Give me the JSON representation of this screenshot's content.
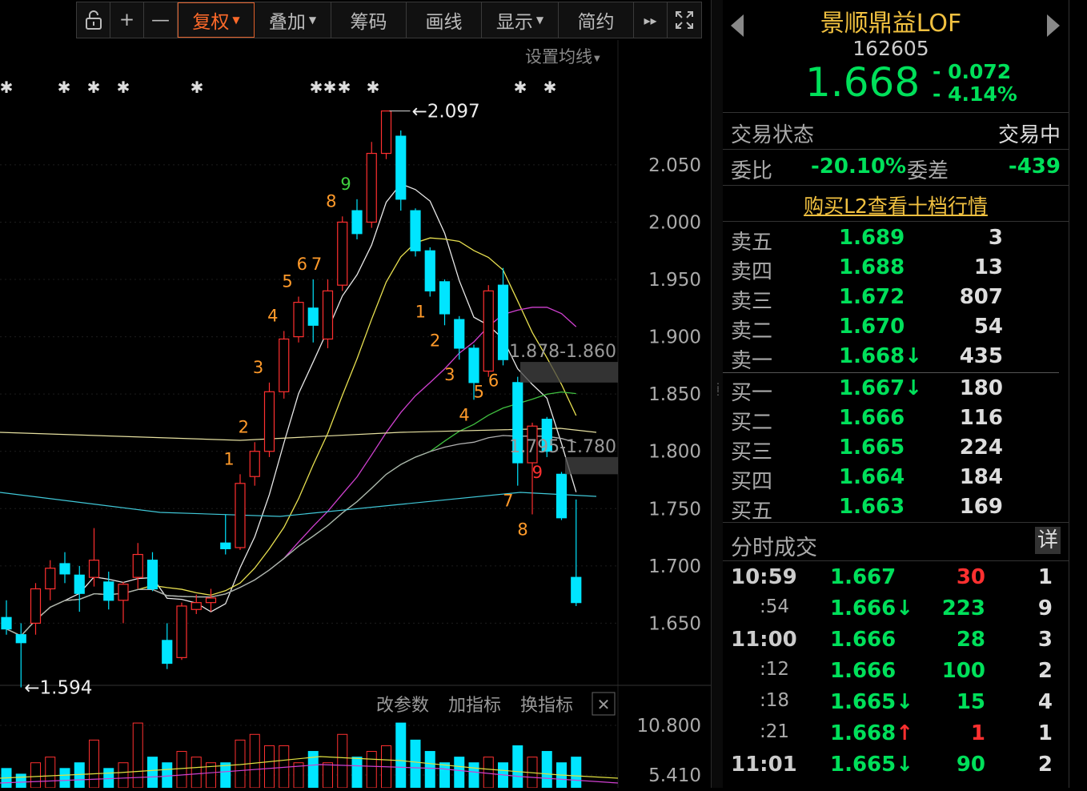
{
  "toolbar": {
    "items": [
      {
        "label": "",
        "icon": "lock-icon"
      },
      {
        "label": "+",
        "icon": "zoom-in-icon"
      },
      {
        "label": "—",
        "icon": "zoom-out-icon"
      },
      {
        "label": "复权",
        "dropdown": true,
        "active": true
      },
      {
        "label": "叠加",
        "dropdown": true
      },
      {
        "label": "筹码"
      },
      {
        "label": "画线"
      },
      {
        "label": "显示",
        "dropdown": true
      },
      {
        "label": "简约"
      },
      {
        "label": "▸▸",
        "icon": "fast-forward-icon"
      },
      {
        "label": "",
        "icon": "fullscreen-icon"
      }
    ]
  },
  "chart": {
    "ma_settings": "设置均线",
    "price_high_label": "2.097",
    "price_low_label": "1.594",
    "box1_label": "1.878-1.860",
    "box2_label": "1.795-1.780",
    "y_ticks": [
      "2.050",
      "2.000",
      "1.950",
      "1.900",
      "1.850",
      "1.800",
      "1.750",
      "1.700",
      "1.650"
    ],
    "indicator_buttons": [
      "改参数",
      "加指标",
      "换指标"
    ],
    "vol_ticks": [
      "10.800",
      "5.410"
    ],
    "td_up": [
      "1",
      "2",
      "3",
      "4",
      "5",
      "6",
      "7",
      "8",
      "9"
    ],
    "td_down": [
      "1",
      "2",
      "3",
      "4",
      "5",
      "6",
      "7",
      "8",
      "9"
    ]
  },
  "chart_data": {
    "type": "candlestick",
    "ylim": [
      1.6,
      2.11
    ],
    "candles": [
      {
        "o": 1.655,
        "c": 1.645,
        "h": 1.67,
        "l": 1.64
      },
      {
        "o": 1.64,
        "c": 1.633,
        "h": 1.65,
        "l": 1.594
      },
      {
        "o": 1.65,
        "c": 1.68,
        "h": 1.685,
        "l": 1.64
      },
      {
        "o": 1.68,
        "c": 1.698,
        "h": 1.705,
        "l": 1.67
      },
      {
        "o": 1.702,
        "c": 1.693,
        "h": 1.712,
        "l": 1.685
      },
      {
        "o": 1.692,
        "c": 1.676,
        "h": 1.7,
        "l": 1.66
      },
      {
        "o": 1.69,
        "c": 1.705,
        "h": 1.733,
        "l": 1.682
      },
      {
        "o": 1.686,
        "c": 1.67,
        "h": 1.695,
        "l": 1.662
      },
      {
        "o": 1.67,
        "c": 1.684,
        "h": 1.686,
        "l": 1.65
      },
      {
        "o": 1.69,
        "c": 1.71,
        "h": 1.72,
        "l": 1.68
      },
      {
        "o": 1.705,
        "c": 1.68,
        "h": 1.712,
        "l": 1.678
      },
      {
        "o": 1.635,
        "c": 1.615,
        "h": 1.65,
        "l": 1.61
      },
      {
        "o": 1.62,
        "c": 1.665,
        "h": 1.668,
        "l": 1.618
      },
      {
        "o": 1.662,
        "c": 1.668,
        "h": 1.675,
        "l": 1.658
      },
      {
        "o": 1.668,
        "c": 1.672,
        "h": 1.68,
        "l": 1.66
      },
      {
        "o": 1.72,
        "c": 1.715,
        "h": 1.745,
        "l": 1.71
      },
      {
        "o": 1.716,
        "c": 1.772,
        "h": 1.78,
        "l": 1.714
      },
      {
        "o": 1.778,
        "c": 1.8,
        "h": 1.808,
        "l": 1.77
      },
      {
        "o": 1.8,
        "c": 1.852,
        "h": 1.86,
        "l": 1.795
      },
      {
        "o": 1.852,
        "c": 1.898,
        "h": 1.905,
        "l": 1.846
      },
      {
        "o": 1.9,
        "c": 1.93,
        "h": 1.935,
        "l": 1.895
      },
      {
        "o": 1.925,
        "c": 1.91,
        "h": 1.95,
        "l": 1.895
      },
      {
        "o": 1.898,
        "c": 1.94,
        "h": 1.95,
        "l": 1.89
      },
      {
        "o": 1.945,
        "c": 2.0,
        "h": 2.005,
        "l": 1.94
      },
      {
        "o": 2.01,
        "c": 1.99,
        "h": 2.02,
        "l": 1.985
      },
      {
        "o": 2.0,
        "c": 2.06,
        "h": 2.07,
        "l": 1.995
      },
      {
        "o": 2.06,
        "c": 2.097,
        "h": 2.097,
        "l": 2.055
      },
      {
        "o": 2.075,
        "c": 2.02,
        "h": 2.08,
        "l": 2.01
      },
      {
        "o": 2.01,
        "c": 1.975,
        "h": 2.012,
        "l": 1.97
      },
      {
        "o": 1.975,
        "c": 1.94,
        "h": 1.978,
        "l": 1.935
      },
      {
        "o": 1.948,
        "c": 1.92,
        "h": 1.95,
        "l": 1.91
      },
      {
        "o": 1.915,
        "c": 1.89,
        "h": 1.918,
        "l": 1.88
      },
      {
        "o": 1.89,
        "c": 1.86,
        "h": 1.893,
        "l": 1.845
      },
      {
        "o": 1.87,
        "c": 1.94,
        "h": 1.945,
        "l": 1.865
      },
      {
        "o": 1.945,
        "c": 1.88,
        "h": 1.96,
        "l": 1.875
      },
      {
        "o": 1.86,
        "c": 1.79,
        "h": 1.865,
        "l": 1.77
      },
      {
        "o": 1.79,
        "c": 1.822,
        "h": 1.825,
        "l": 1.745
      },
      {
        "o": 1.828,
        "c": 1.8,
        "h": 1.83,
        "l": 1.795
      },
      {
        "o": 1.78,
        "c": 1.742,
        "h": 1.782,
        "l": 1.74
      },
      {
        "o": 1.69,
        "c": 1.668,
        "h": 1.758,
        "l": 1.665
      }
    ],
    "volume": [
      2,
      1,
      3,
      4,
      2,
      3,
      7,
      2,
      3,
      10,
      4,
      3,
      5,
      4,
      3,
      3,
      7,
      8,
      6,
      6,
      3,
      5,
      3,
      8,
      4,
      5,
      6,
      10,
      7,
      5,
      3,
      4,
      3,
      4,
      3,
      6,
      4,
      5,
      3,
      4
    ],
    "vol_ylim": [
      0,
      11
    ]
  },
  "quote": {
    "name": "景顺鼎益LOF",
    "code": "162605",
    "price": "1.668",
    "change": "- 0.072",
    "change_pct": "- 4.14%",
    "status_label": "交易状态",
    "status_value": "交易中",
    "ratio_label": "委比",
    "ratio_value": "-20.10%",
    "diff_label": "委差",
    "diff_value": "-439",
    "l2_link": "购买L2查看十档行情",
    "asks": [
      {
        "label": "卖五",
        "price": "1.689",
        "vol": "3",
        "arrow": ""
      },
      {
        "label": "卖四",
        "price": "1.688",
        "vol": "13",
        "arrow": ""
      },
      {
        "label": "卖三",
        "price": "1.672",
        "vol": "807",
        "arrow": ""
      },
      {
        "label": "卖二",
        "price": "1.670",
        "vol": "54",
        "arrow": ""
      },
      {
        "label": "卖一",
        "price": "1.668",
        "vol": "435",
        "arrow": "↓"
      }
    ],
    "bids": [
      {
        "label": "买一",
        "price": "1.667",
        "vol": "180",
        "arrow": "↓"
      },
      {
        "label": "买二",
        "price": "1.666",
        "vol": "116",
        "arrow": ""
      },
      {
        "label": "买三",
        "price": "1.665",
        "vol": "224",
        "arrow": ""
      },
      {
        "label": "买四",
        "price": "1.664",
        "vol": "184",
        "arrow": ""
      },
      {
        "label": "买五",
        "price": "1.663",
        "vol": "169",
        "arrow": ""
      }
    ],
    "ticks_title": "分时成交",
    "ticks_detail": "详",
    "ticks": [
      {
        "time": "10:59",
        "sub": false,
        "price": "1.667",
        "arrow": "",
        "vol": "30",
        "vcolor": "red",
        "n": "1"
      },
      {
        "time": ":54",
        "sub": true,
        "price": "1.666",
        "arrow": "↓",
        "vol": "223",
        "vcolor": "green",
        "n": "9"
      },
      {
        "time": "11:00",
        "sub": false,
        "price": "1.666",
        "arrow": "",
        "vol": "28",
        "vcolor": "green",
        "n": "3"
      },
      {
        "time": ":12",
        "sub": true,
        "price": "1.666",
        "arrow": "",
        "vol": "100",
        "vcolor": "green",
        "n": "2"
      },
      {
        "time": ":18",
        "sub": true,
        "price": "1.665",
        "arrow": "↓",
        "vol": "15",
        "vcolor": "green",
        "n": "4"
      },
      {
        "time": ":21",
        "sub": true,
        "price": "1.668",
        "arrow": "↑",
        "vol": "1",
        "vcolor": "red",
        "n": "1"
      },
      {
        "time": "11:01",
        "sub": false,
        "price": "1.665",
        "arrow": "↓",
        "vol": "90",
        "vcolor": "green",
        "n": "2"
      }
    ]
  },
  "colors": {
    "up": "#ff3030",
    "down": "#00e5ff",
    "green": "#00e05a",
    "gold": "#f0c040"
  }
}
